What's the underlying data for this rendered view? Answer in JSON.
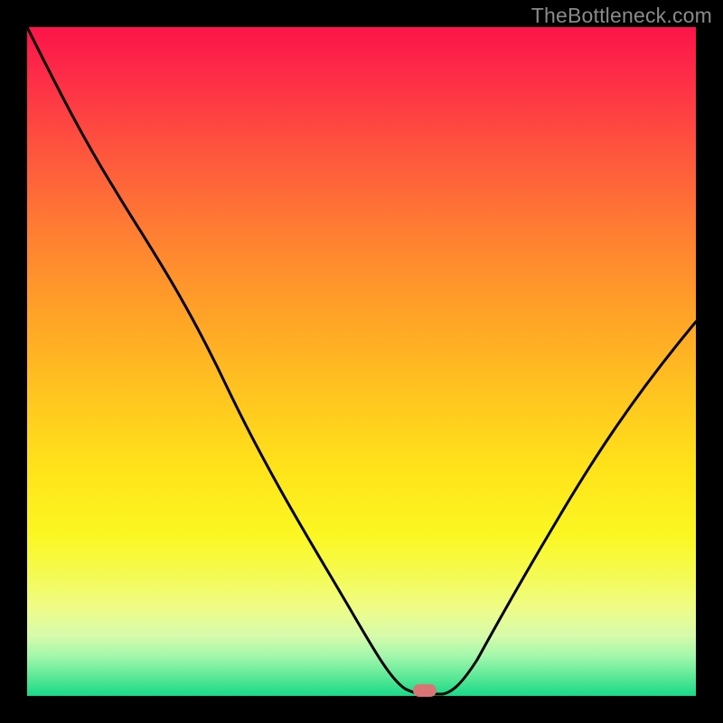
{
  "watermark": "TheBottleneck.com",
  "marker": {
    "x_frac": 0.595,
    "y_frac": 0.992
  },
  "chart_data": {
    "type": "line",
    "title": "",
    "xlabel": "",
    "ylabel": "",
    "xlim": [
      0,
      1
    ],
    "ylim": [
      0,
      1
    ],
    "annotations": [
      "TheBottleneck.com"
    ],
    "gradient_stops": [
      {
        "pos": 0.0,
        "color": "#fc1449"
      },
      {
        "pos": 0.08,
        "color": "#fd2f47"
      },
      {
        "pos": 0.2,
        "color": "#fe5a3c"
      },
      {
        "pos": 0.3,
        "color": "#ff7c33"
      },
      {
        "pos": 0.42,
        "color": "#ffa028"
      },
      {
        "pos": 0.54,
        "color": "#ffc220"
      },
      {
        "pos": 0.66,
        "color": "#ffe31a"
      },
      {
        "pos": 0.76,
        "color": "#fbf722"
      },
      {
        "pos": 0.82,
        "color": "#f4fb53"
      },
      {
        "pos": 0.87,
        "color": "#eefc88"
      },
      {
        "pos": 0.91,
        "color": "#d6fbaa"
      },
      {
        "pos": 0.94,
        "color": "#a3f7ac"
      },
      {
        "pos": 0.97,
        "color": "#5fe998"
      },
      {
        "pos": 1.0,
        "color": "#18d988"
      }
    ],
    "series": [
      {
        "name": "bottleneck-curve",
        "x": [
          0.0,
          0.06,
          0.13,
          0.21,
          0.3,
          0.39,
          0.47,
          0.53,
          0.56,
          0.58,
          0.62,
          0.65,
          0.7,
          0.76,
          0.83,
          0.91,
          1.0
        ],
        "y": [
          1.0,
          0.88,
          0.76,
          0.64,
          0.54,
          0.43,
          0.31,
          0.19,
          0.1,
          0.02,
          0.01,
          0.02,
          0.09,
          0.19,
          0.31,
          0.43,
          0.56
        ]
      }
    ],
    "marker": {
      "x": 0.595,
      "y": 0.008,
      "color": "#da7576"
    }
  }
}
